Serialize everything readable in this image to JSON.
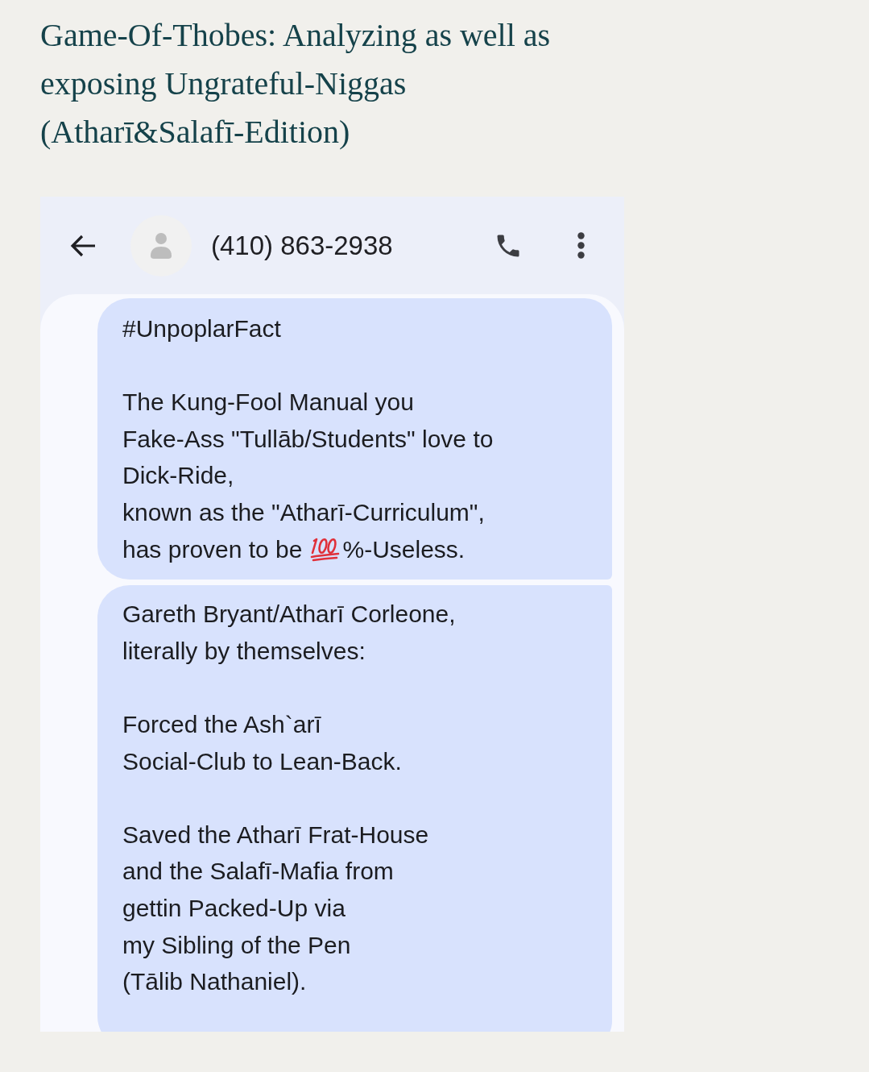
{
  "title": "Game-Of-Thobes: Analyzing as well as exposing Ungrateful-Niggas (Atharī&Salafī-Edition)",
  "conversation": {
    "contact": "(410) 863-2938",
    "messages": [
      {
        "paragraphs": [
          {
            "lines": [
              {
                "kind": "text",
                "text": "#UnpoplarFact"
              }
            ]
          },
          {
            "lines": [
              {
                "kind": "text",
                "text": "The Kung-Fool Manual you"
              },
              {
                "kind": "text",
                "text": "Fake-Ass \"Tullāb/Students\" love to"
              },
              {
                "kind": "text",
                "text": "Dick-Ride,"
              },
              {
                "kind": "text",
                "text": "known as the \"Atharī-Curriculum\","
              },
              {
                "kind": "emoji",
                "before": "has proven to be",
                "after": "%-Useless."
              }
            ]
          }
        ]
      },
      {
        "paragraphs": [
          {
            "lines": [
              {
                "kind": "text",
                "text": "Gareth Bryant/Atharī Corleone,"
              },
              {
                "kind": "text",
                "text": "literally by themselves:"
              }
            ]
          },
          {
            "lines": [
              {
                "kind": "text",
                "text": "Forced the Ash`arī"
              },
              {
                "kind": "text",
                "text": "Social-Club to Lean-Back."
              }
            ]
          },
          {
            "lines": [
              {
                "kind": "text",
                "text": "Saved the Atharī Frat-House"
              },
              {
                "kind": "text",
                "text": "and the Salafī-Mafia from"
              },
              {
                "kind": "text",
                "text": "gettin Packed-Up via"
              },
              {
                "kind": "text",
                "text": "my Sibling of the Pen"
              },
              {
                "kind": "text",
                "text": "(Tālib Nathaniel)."
              }
            ]
          }
        ]
      }
    ]
  }
}
